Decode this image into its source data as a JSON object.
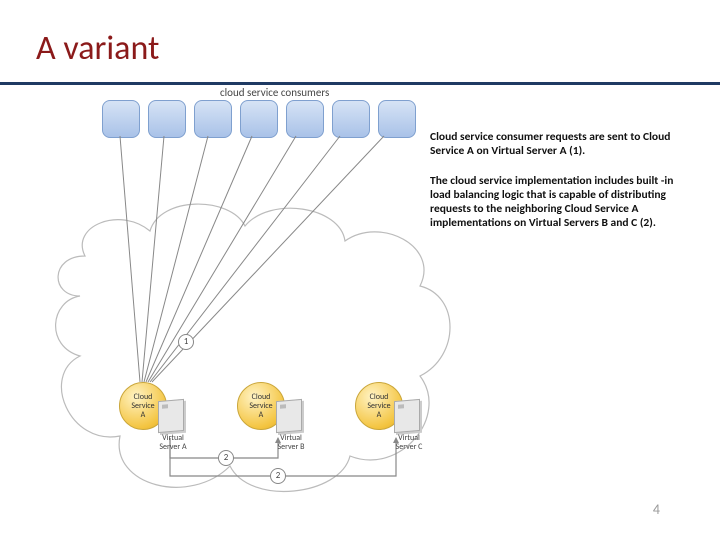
{
  "title": "A variant",
  "consumers_label": "cloud service consumers",
  "consumer_count": 7,
  "paragraph1": "Cloud service consumer requests are sent to Cloud Service A on Virtual Server A (1).",
  "paragraph2": "The cloud service implementation includes built -in load balancing logic that is capable of distributing requests to the neighboring Cloud Service A implementations on Virtual Servers B and C (2).",
  "service_label_top": "Cloud",
  "service_label_mid": "Service",
  "service_label_bot": "A",
  "server_a": "Virtual\nServer A",
  "server_b": "Virtual\nServer B",
  "server_c": "Virtual\nServer C",
  "step1": "1",
  "step2a": "2",
  "step2b": "2",
  "page_number": "4"
}
